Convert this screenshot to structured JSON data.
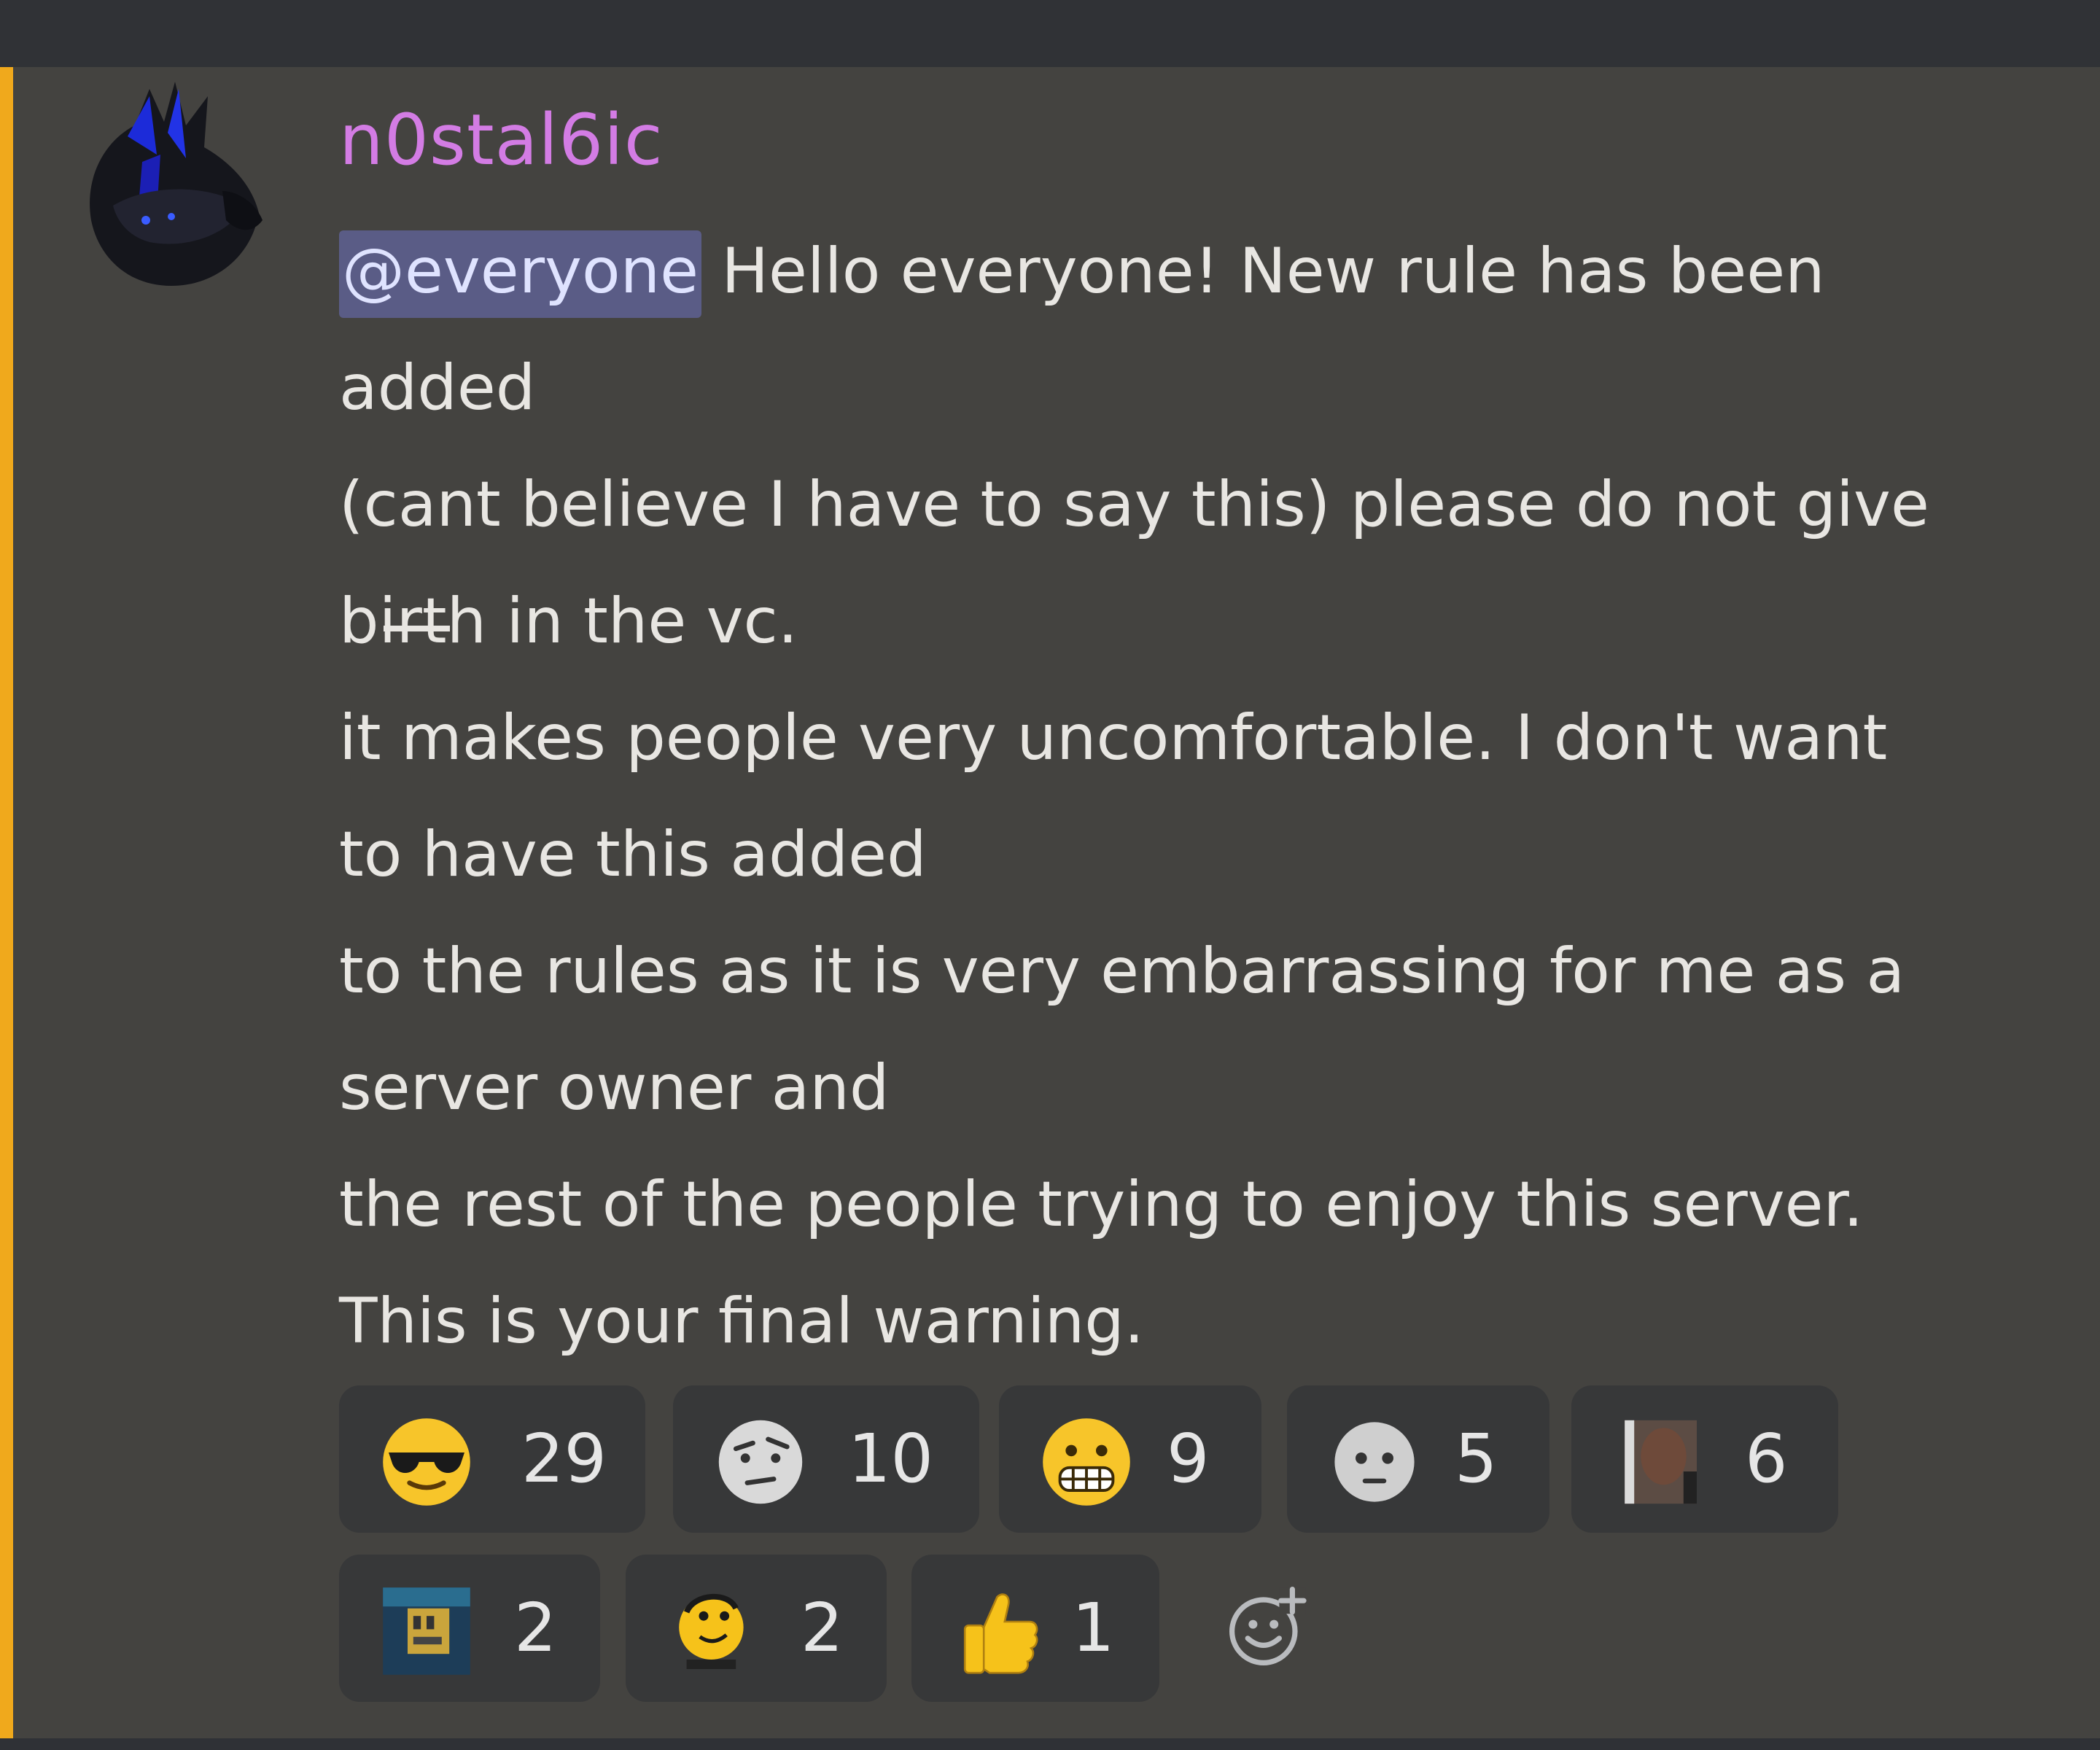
{
  "message": {
    "author": "n0stal6ic",
    "mention": "@everyone",
    "first_line_rest": " Hello everyone! New rule has been",
    "lines": [
      "added",
      "(cant believe I have to say this) please do not give",
      null,
      "it makes people very uncomfortable. I don't want",
      "to have this added",
      "to the rules as it is very embarrassing for me as a",
      "server owner and",
      "the rest of the people trying to enjoy this server.",
      "This is your final warning."
    ],
    "birth_line": {
      "prefix": "b",
      "struck": "irt",
      "suffix": "h in the vc."
    }
  },
  "reactions": [
    {
      "emoji": "sunglasses-face-icon",
      "count": "29"
    },
    {
      "emoji": "raised-eyebrow-face-icon",
      "count": "10"
    },
    {
      "emoji": "grimacing-face-icon",
      "count": "9"
    },
    {
      "emoji": "neutral-gray-face-icon",
      "count": "5"
    },
    {
      "emoji": "photo-face-custom-icon",
      "count": "6"
    },
    {
      "emoji": "custom-image-emoji-icon",
      "count": "2"
    },
    {
      "emoji": "custom-yellow-face-icon",
      "count": "2"
    },
    {
      "emoji": "thumbs-up-icon",
      "count": "1"
    }
  ],
  "colors": {
    "accent": "#f0a91c",
    "username": "#d37ce4",
    "mention_bg": "#5a5c86",
    "message_bg": "#444340"
  }
}
